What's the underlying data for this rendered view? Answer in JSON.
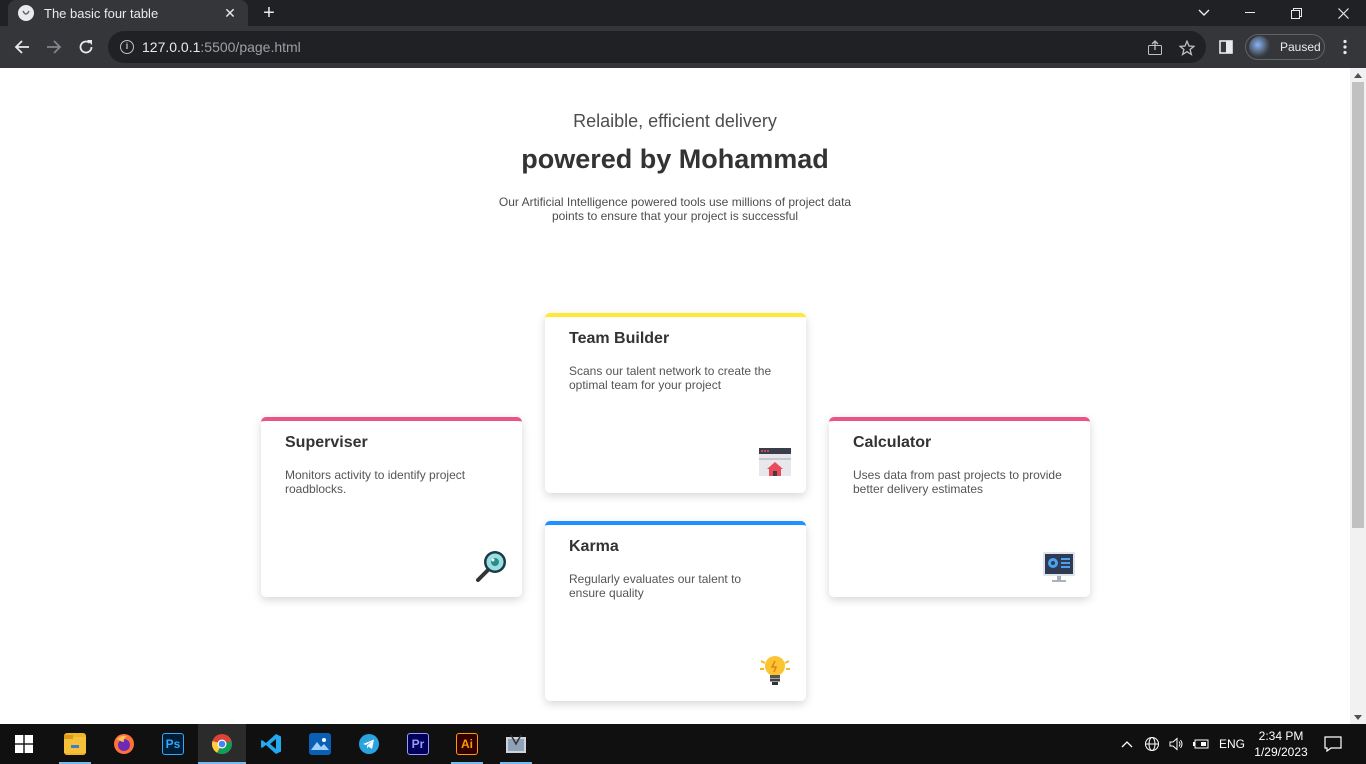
{
  "browser": {
    "tab_title": "The basic four table",
    "url_host": "127.0.0.1",
    "url_rest": ":5500/page.html",
    "profile_label": "Paused"
  },
  "page": {
    "subheading": "Relaible, efficient delivery",
    "heading": "powered by Mohammad",
    "intro": "Our Artificial Intelligence powered tools use millions of project data points to ensure that your project is successful",
    "cards": [
      {
        "title": "Superviser",
        "desc": "Monitors activity to identify project roadblocks.",
        "accent": "#ea5455",
        "icon": "magnifier-icon"
      },
      {
        "title": "Team Builder",
        "desc": "Scans our talent network to create the optimal team for your project",
        "accent": "#fce938",
        "icon": "team-builder-icon"
      },
      {
        "title": "Karma",
        "desc": "Regularly evaluates our talent to ensure quality",
        "accent": "#1e90ff",
        "icon": "lightbulb-icon"
      },
      {
        "title": "Calculator",
        "desc": "Uses data from past projects to provide better delivery estimates",
        "accent": "#ea5488",
        "icon": "monitor-icon"
      }
    ]
  },
  "taskbar": {
    "apps": [
      "File Explorer",
      "Firefox",
      "Photoshop",
      "Chrome",
      "Visual Studio Code",
      "Photos",
      "Telegram",
      "Premiere Pro",
      "Illustrator",
      "Snipping Tool"
    ],
    "lang": "ENG",
    "time": "2:34 PM",
    "date": "1/29/2023"
  }
}
